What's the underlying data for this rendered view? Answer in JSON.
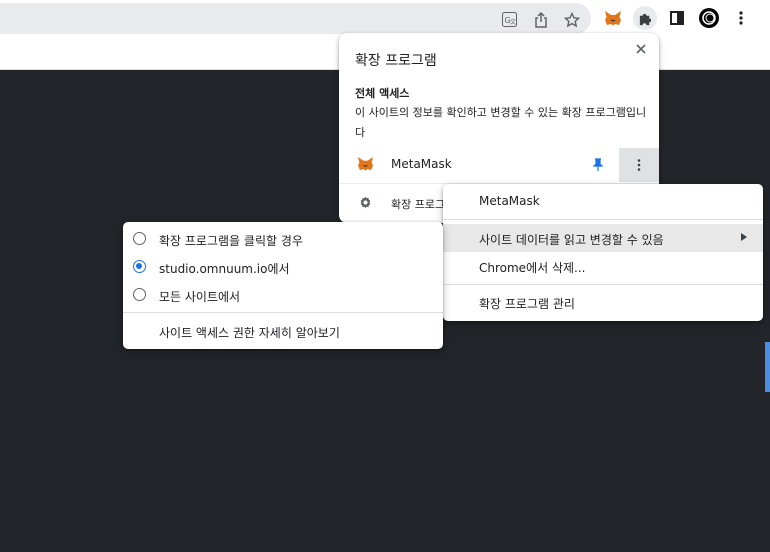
{
  "browser": {
    "toolbar_icons": [
      "translate-icon",
      "share-icon",
      "star-icon",
      "metamask-fox-icon",
      "puzzle-icon",
      "side-panel-icon",
      "profile-icon",
      "more-vert-icon"
    ]
  },
  "extensions_panel": {
    "title": "확장 프로그램",
    "section_heading": "전체 액세스",
    "section_description": "이 사이트의 정보를 확인하고 변경할 수 있는 확장 프로그램입니다",
    "extensions": [
      {
        "name": "MetaMask",
        "pinned": true
      }
    ],
    "manage_label": "확장 프로그램 관리",
    "pin_color": "#1a73e8"
  },
  "context_menu": {
    "items": [
      {
        "label": "MetaMask"
      },
      {
        "label": "사이트 데이터를 읽고 변경할 수 있음",
        "has_submenu": true
      },
      {
        "label": "Chrome에서 삭제..."
      },
      {
        "label": "확장 프로그램 관리"
      }
    ]
  },
  "site_access_submenu": {
    "options": [
      {
        "label": "확장 프로그램을 클릭할 경우",
        "selected": false
      },
      {
        "label": "studio.omnuum.io에서",
        "selected": true
      },
      {
        "label": "모든 사이트에서",
        "selected": false
      }
    ],
    "learn_more": "사이트 액세스 권한 자세히 알아보기",
    "accent_color": "#1a73e8"
  }
}
